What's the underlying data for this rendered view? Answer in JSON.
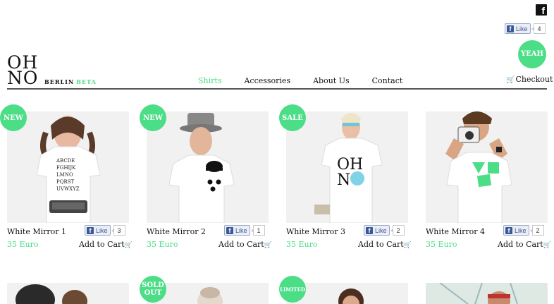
{
  "header": {
    "facebook_glyph": "f",
    "top_like": {
      "label": "Like",
      "count": "4"
    },
    "badge": "YEAH",
    "logo": {
      "line1": "OH",
      "line2": "NO",
      "city": "BERLIN",
      "stage": "BETA"
    },
    "nav": [
      "Shirts",
      "Accessories",
      "About Us",
      "Contact"
    ],
    "active_nav": "Shirts",
    "checkout": "Checkout",
    "cart_icon": "cart-icon"
  },
  "products": [
    {
      "badge": "NEW",
      "name": "White Mirror 1",
      "price": "35 Euro",
      "like": "Like",
      "likes": "3",
      "add_to_cart": "Add to Cart"
    },
    {
      "badge": "NEW",
      "name": "White Mirror 2",
      "price": "35 Euro",
      "like": "Like",
      "likes": "1",
      "add_to_cart": "Add to Cart"
    },
    {
      "badge": "SALE",
      "name": "White Mirror 3",
      "price": "35 Euro",
      "like": "Like",
      "likes": "2",
      "add_to_cart": "Add to Cart"
    },
    {
      "badge": "",
      "name": "White Mirror 4",
      "price": "35 Euro",
      "like": "Like",
      "likes": "2",
      "add_to_cart": "Add to Cart"
    }
  ],
  "second_row": [
    {
      "badge": ""
    },
    {
      "badge": "SOLD OUT"
    },
    {
      "badge": "LIMITED"
    },
    {
      "badge": ""
    }
  ],
  "colors": {
    "accent": "#4cdd87",
    "facebook": "#3b5998"
  }
}
